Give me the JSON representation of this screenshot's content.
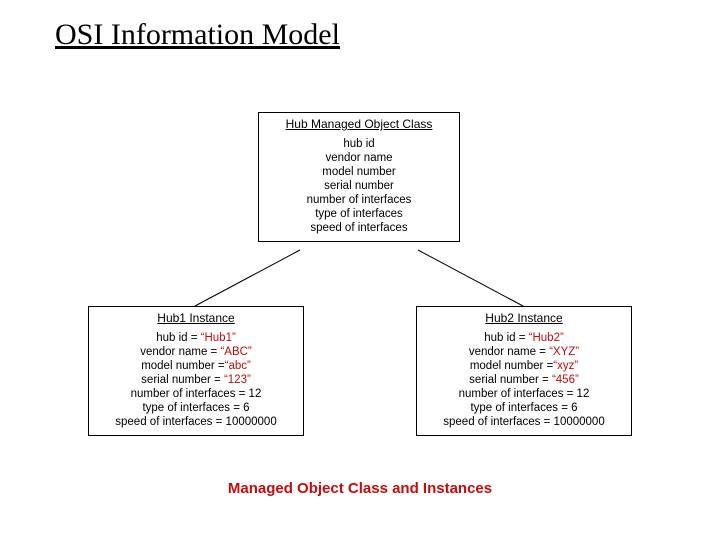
{
  "title": "OSI Information Model",
  "class_box": {
    "header": "Hub Managed Object Class",
    "attrs": {
      "hub_id": "hub id",
      "vendor_name": "vendor name",
      "model_number": "model number",
      "serial_number": "serial number",
      "num_interfaces": "number of interfaces",
      "type_interfaces": "type of interfaces",
      "speed_interfaces": "speed of interfaces"
    }
  },
  "instances": [
    {
      "header": "Hub1 Instance",
      "rows": {
        "hub_id_label": "hub id = ",
        "hub_id_value": "“Hub1”",
        "vendor_label": "vendor name = ",
        "vendor_value": "“ABC”",
        "model_label": "model number =",
        "model_value": "“abc”",
        "serial_label": "serial number = ",
        "serial_value": "“123”",
        "numif_label": "number of interfaces = 12",
        "typeif_label": "type of interfaces = 6",
        "speedif_label": "speed of interfaces = 10000000"
      }
    },
    {
      "header": "Hub2 Instance",
      "rows": {
        "hub_id_label": "hub id = ",
        "hub_id_value": "“Hub2”",
        "vendor_label": "vendor name = ",
        "vendor_value": "“XYZ”",
        "model_label": "model number =",
        "model_value": "“xyz”",
        "serial_label": "serial number = ",
        "serial_value": "“456”",
        "numif_label": "number of interfaces = 12",
        "typeif_label": "type of interfaces = 6",
        "speedif_label": "speed of interfaces = 10000000"
      }
    }
  ],
  "caption": "Managed Object Class and Instances"
}
